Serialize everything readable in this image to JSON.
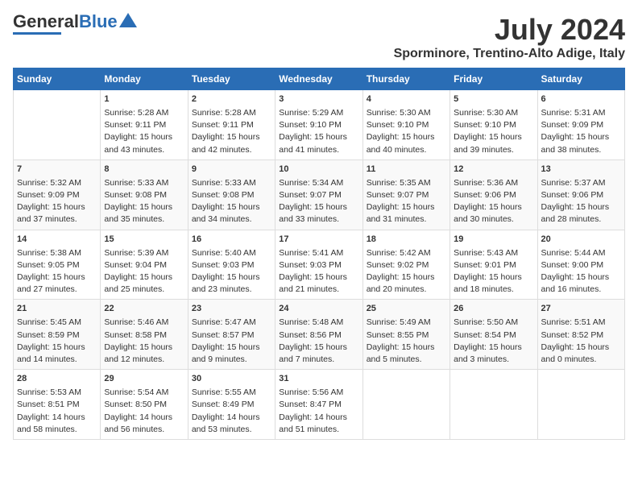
{
  "header": {
    "logo_general": "General",
    "logo_blue": "Blue",
    "month": "July 2024",
    "location": "Sporminore, Trentino-Alto Adige, Italy"
  },
  "days_of_week": [
    "Sunday",
    "Monday",
    "Tuesday",
    "Wednesday",
    "Thursday",
    "Friday",
    "Saturday"
  ],
  "weeks": [
    [
      {
        "day": "",
        "content": ""
      },
      {
        "day": "1",
        "content": "Sunrise: 5:28 AM\nSunset: 9:11 PM\nDaylight: 15 hours\nand 43 minutes."
      },
      {
        "day": "2",
        "content": "Sunrise: 5:28 AM\nSunset: 9:11 PM\nDaylight: 15 hours\nand 42 minutes."
      },
      {
        "day": "3",
        "content": "Sunrise: 5:29 AM\nSunset: 9:10 PM\nDaylight: 15 hours\nand 41 minutes."
      },
      {
        "day": "4",
        "content": "Sunrise: 5:30 AM\nSunset: 9:10 PM\nDaylight: 15 hours\nand 40 minutes."
      },
      {
        "day": "5",
        "content": "Sunrise: 5:30 AM\nSunset: 9:10 PM\nDaylight: 15 hours\nand 39 minutes."
      },
      {
        "day": "6",
        "content": "Sunrise: 5:31 AM\nSunset: 9:09 PM\nDaylight: 15 hours\nand 38 minutes."
      }
    ],
    [
      {
        "day": "7",
        "content": "Sunrise: 5:32 AM\nSunset: 9:09 PM\nDaylight: 15 hours\nand 37 minutes."
      },
      {
        "day": "8",
        "content": "Sunrise: 5:33 AM\nSunset: 9:08 PM\nDaylight: 15 hours\nand 35 minutes."
      },
      {
        "day": "9",
        "content": "Sunrise: 5:33 AM\nSunset: 9:08 PM\nDaylight: 15 hours\nand 34 minutes."
      },
      {
        "day": "10",
        "content": "Sunrise: 5:34 AM\nSunset: 9:07 PM\nDaylight: 15 hours\nand 33 minutes."
      },
      {
        "day": "11",
        "content": "Sunrise: 5:35 AM\nSunset: 9:07 PM\nDaylight: 15 hours\nand 31 minutes."
      },
      {
        "day": "12",
        "content": "Sunrise: 5:36 AM\nSunset: 9:06 PM\nDaylight: 15 hours\nand 30 minutes."
      },
      {
        "day": "13",
        "content": "Sunrise: 5:37 AM\nSunset: 9:06 PM\nDaylight: 15 hours\nand 28 minutes."
      }
    ],
    [
      {
        "day": "14",
        "content": "Sunrise: 5:38 AM\nSunset: 9:05 PM\nDaylight: 15 hours\nand 27 minutes."
      },
      {
        "day": "15",
        "content": "Sunrise: 5:39 AM\nSunset: 9:04 PM\nDaylight: 15 hours\nand 25 minutes."
      },
      {
        "day": "16",
        "content": "Sunrise: 5:40 AM\nSunset: 9:03 PM\nDaylight: 15 hours\nand 23 minutes."
      },
      {
        "day": "17",
        "content": "Sunrise: 5:41 AM\nSunset: 9:03 PM\nDaylight: 15 hours\nand 21 minutes."
      },
      {
        "day": "18",
        "content": "Sunrise: 5:42 AM\nSunset: 9:02 PM\nDaylight: 15 hours\nand 20 minutes."
      },
      {
        "day": "19",
        "content": "Sunrise: 5:43 AM\nSunset: 9:01 PM\nDaylight: 15 hours\nand 18 minutes."
      },
      {
        "day": "20",
        "content": "Sunrise: 5:44 AM\nSunset: 9:00 PM\nDaylight: 15 hours\nand 16 minutes."
      }
    ],
    [
      {
        "day": "21",
        "content": "Sunrise: 5:45 AM\nSunset: 8:59 PM\nDaylight: 15 hours\nand 14 minutes."
      },
      {
        "day": "22",
        "content": "Sunrise: 5:46 AM\nSunset: 8:58 PM\nDaylight: 15 hours\nand 12 minutes."
      },
      {
        "day": "23",
        "content": "Sunrise: 5:47 AM\nSunset: 8:57 PM\nDaylight: 15 hours\nand 9 minutes."
      },
      {
        "day": "24",
        "content": "Sunrise: 5:48 AM\nSunset: 8:56 PM\nDaylight: 15 hours\nand 7 minutes."
      },
      {
        "day": "25",
        "content": "Sunrise: 5:49 AM\nSunset: 8:55 PM\nDaylight: 15 hours\nand 5 minutes."
      },
      {
        "day": "26",
        "content": "Sunrise: 5:50 AM\nSunset: 8:54 PM\nDaylight: 15 hours\nand 3 minutes."
      },
      {
        "day": "27",
        "content": "Sunrise: 5:51 AM\nSunset: 8:52 PM\nDaylight: 15 hours\nand 0 minutes."
      }
    ],
    [
      {
        "day": "28",
        "content": "Sunrise: 5:53 AM\nSunset: 8:51 PM\nDaylight: 14 hours\nand 58 minutes."
      },
      {
        "day": "29",
        "content": "Sunrise: 5:54 AM\nSunset: 8:50 PM\nDaylight: 14 hours\nand 56 minutes."
      },
      {
        "day": "30",
        "content": "Sunrise: 5:55 AM\nSunset: 8:49 PM\nDaylight: 14 hours\nand 53 minutes."
      },
      {
        "day": "31",
        "content": "Sunrise: 5:56 AM\nSunset: 8:47 PM\nDaylight: 14 hours\nand 51 minutes."
      },
      {
        "day": "",
        "content": ""
      },
      {
        "day": "",
        "content": ""
      },
      {
        "day": "",
        "content": ""
      }
    ]
  ]
}
